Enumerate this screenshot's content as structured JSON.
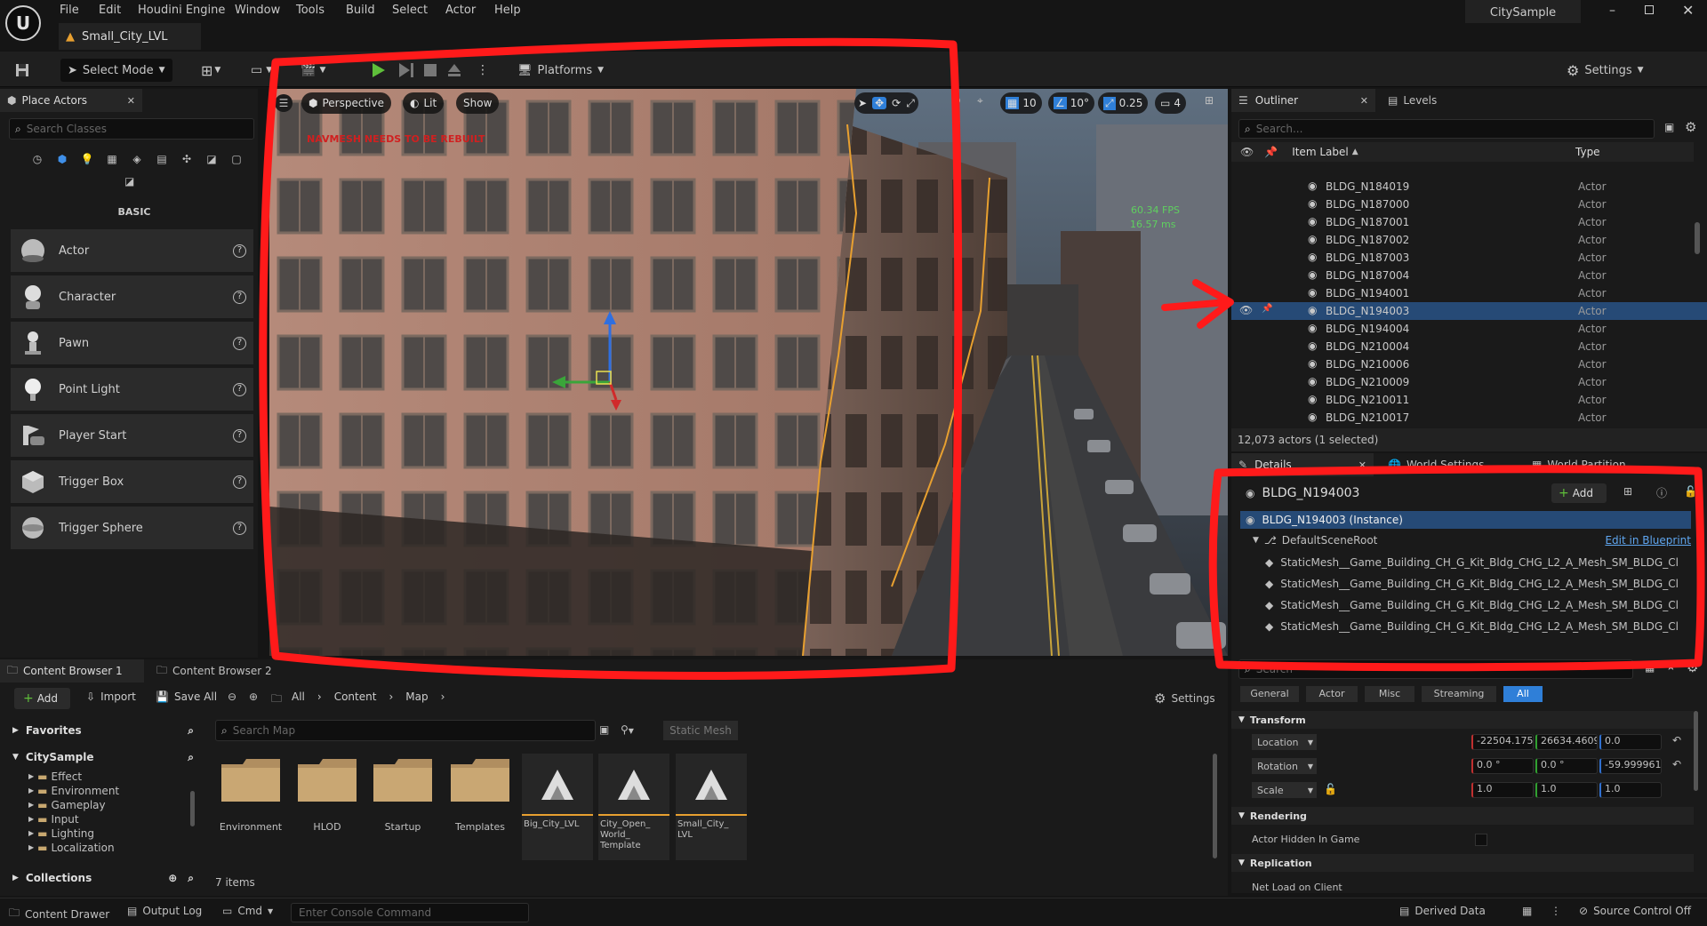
{
  "menu": [
    "File",
    "Edit",
    "Houdini Engine",
    "Window",
    "Tools",
    "Build",
    "Select",
    "Actor",
    "Help"
  ],
  "project_name": "CitySample",
  "level_tab": "Small_City_LVL",
  "toolbar": {
    "select_mode": "Select Mode",
    "platforms": "Platforms",
    "settings": "Settings"
  },
  "place_actors": {
    "title": "Place Actors",
    "search_placeholder": "Search Classes",
    "category": "BASIC",
    "items": [
      "Actor",
      "Character",
      "Pawn",
      "Point Light",
      "Player Start",
      "Trigger Box",
      "Trigger Sphere"
    ]
  },
  "viewport": {
    "perspective": "Perspective",
    "lit": "Lit",
    "show": "Show",
    "grid_snap": "10",
    "rot_snap": "10°",
    "scale_snap": "0.25",
    "camera_speed": "4",
    "warning": "NAVMESH NEEDS TO BE REBUILT",
    "fps": "60.34 FPS",
    "ms": "16.57 ms"
  },
  "outliner": {
    "title": "Outliner",
    "levels_tab": "Levels",
    "search_placeholder": "Search...",
    "col_label": "Item Label",
    "col_type": "Type",
    "rows": [
      {
        "label": "BLDG_N184019",
        "type": "Actor"
      },
      {
        "label": "BLDG_N187000",
        "type": "Actor"
      },
      {
        "label": "BLDG_N187001",
        "type": "Actor"
      },
      {
        "label": "BLDG_N187002",
        "type": "Actor"
      },
      {
        "label": "BLDG_N187003",
        "type": "Actor"
      },
      {
        "label": "BLDG_N187004",
        "type": "Actor"
      },
      {
        "label": "BLDG_N194001",
        "type": "Actor"
      },
      {
        "label": "BLDG_N194003",
        "type": "Actor"
      },
      {
        "label": "BLDG_N194004",
        "type": "Actor"
      },
      {
        "label": "BLDG_N210004",
        "type": "Actor"
      },
      {
        "label": "BLDG_N210006",
        "type": "Actor"
      },
      {
        "label": "BLDG_N210009",
        "type": "Actor"
      },
      {
        "label": "BLDG_N210011",
        "type": "Actor"
      },
      {
        "label": "BLDG_N210017",
        "type": "Actor"
      }
    ],
    "selected_index": 7,
    "footer": "12,073 actors (1 selected)"
  },
  "details": {
    "tab": "Details",
    "world_settings_tab": "World Settings",
    "world_partition_tab": "World Partition",
    "actor_name": "BLDG_N194003",
    "add_label": "Add",
    "instance": "BLDG_N194003 (Instance)",
    "root": "DefaultSceneRoot",
    "edit_blueprint": "Edit in Blueprint",
    "components": [
      "StaticMesh__Game_Building_CH_G_Kit_Bldg_CHG_L2_A_Mesh_SM_BLDG_Cl",
      "StaticMesh__Game_Building_CH_G_Kit_Bldg_CHG_L2_A_Mesh_SM_BLDG_Cl",
      "StaticMesh__Game_Building_CH_G_Kit_Bldg_CHG_L2_A_Mesh_SM_BLDG_Cl",
      "StaticMesh__Game_Building_CH_G_Kit_Bldg_CHG_L2_A_Mesh_SM_BLDG_Cl"
    ],
    "search_placeholder": "Search",
    "filters": [
      "General",
      "Actor",
      "Misc",
      "Streaming",
      "All"
    ],
    "transform_header": "Transform",
    "location_label": "Location",
    "rotation_label": "Rotation",
    "scale_label": "Scale",
    "location": [
      "-22504.175",
      "26634.4609",
      "0.0"
    ],
    "rotation": [
      "0.0 °",
      "0.0 °",
      "-59.999961"
    ],
    "scale": [
      "1.0",
      "1.0",
      "1.0"
    ],
    "rendering_header": "Rendering",
    "hidden_in_game": "Actor Hidden In Game",
    "replication_header": "Replication",
    "net_load": "Net Load on Client"
  },
  "content_browser": {
    "tab1": "Content Browser 1",
    "tab2": "Content Browser 2",
    "add": "Add",
    "import": "Import",
    "save_all": "Save All",
    "path": [
      "All",
      "Content",
      "Map"
    ],
    "settings": "Settings",
    "favorites": "Favorites",
    "root": "CitySample",
    "tree": [
      "Effect",
      "Environment",
      "Gameplay",
      "Input",
      "Lighting",
      "Localization"
    ],
    "collections": "Collections",
    "search_placeholder": "Search Map",
    "filter_chip": "Static Mesh",
    "folders": [
      "Environment",
      "HLOD",
      "Startup",
      "Templates"
    ],
    "assets": [
      "Big_City_LVL",
      "City_Open_\nWorld_\nTemplate",
      "Small_City_\nLVL"
    ],
    "item_count": "7 items"
  },
  "statusbar": {
    "content_drawer": "Content Drawer",
    "output_log": "Output Log",
    "cmd": "Cmd",
    "console_placeholder": "Enter Console Command",
    "derived_data": "Derived Data",
    "source_control": "Source Control Off"
  },
  "colors": {
    "accent_blue": "#2f7fd8",
    "annotation_red": "#ff1a1a",
    "play_green": "#5fbf3a",
    "selection": "#264a76"
  }
}
